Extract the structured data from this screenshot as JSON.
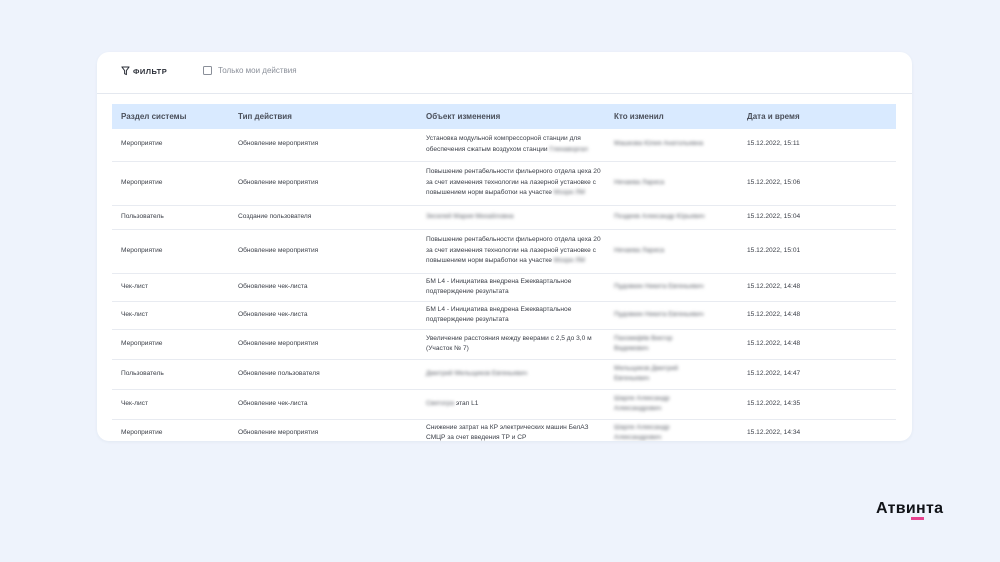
{
  "toolbar": {
    "filter_label": "ФИЛЬТР",
    "mine_only_label": "Только мои действия"
  },
  "table": {
    "columns": [
      "Раздел системы",
      "Тип действия",
      "Объект изменения",
      "Кто изменил",
      "Дата и время"
    ],
    "rows": [
      {
        "section": "Мероприятие",
        "action": "Обновление мероприятия",
        "object": "Установка модульной компрессорной станции для обеспечения сжатым воздухом станции",
        "object_blur": "Гленаворгал",
        "who": "Машкова Юлия Анатольевна",
        "who2": "",
        "date": "15.12.2022, 15:11"
      },
      {
        "section": "Мероприятие",
        "action": "Обновление мероприятия",
        "object": "Повышение рентабельности фильерного отдела цеха 20 за счет изменения технологии на лазерной установке с повышением норм выработки на участке",
        "object_blur": "Мозри ЛМ",
        "who": "Нечаева Лариса",
        "who2": "",
        "date": "15.12.2022, 15:06"
      },
      {
        "section": "Пользователь",
        "action": "Создание пользователя",
        "object": "",
        "object_blur": "Зеселей Мария Михайловна",
        "who": "Поздеев Александр Юрьевич",
        "who2": "",
        "date": "15.12.2022, 15:04"
      },
      {
        "section": "Мероприятие",
        "action": "Обновление мероприятия",
        "object": "Повышение рентабельности фильерного отдела цеха 20 за счет изменения технологии на лазерной установке с повышением норм выработки на участке",
        "object_blur": "Мозри ЛМ",
        "who": "Нечаева Лариса",
        "who2": "",
        "date": "15.12.2022, 15:01"
      },
      {
        "section": "Чек-лист",
        "action": "Обновление чек-листа",
        "object": "БМ L4 - Инициатива внедрена Ежеквартальное подтверждение результата",
        "object_blur": "",
        "who": "Пудовкин Никита Евгеньевич",
        "who2": "",
        "date": "15.12.2022, 14:48"
      },
      {
        "section": "Чек-лист",
        "action": "Обновление чек-листа",
        "object": "БМ L4 - Инициатива внедрена Ежеквартальное подтверждение результата",
        "object_blur": "",
        "who": "Пудовкин Никита Евгеньевич",
        "who2": "",
        "date": "15.12.2022, 14:48"
      },
      {
        "section": "Мероприятие",
        "action": "Обновление мероприятия",
        "object": "Увеличение расстояния между веерами с 2,5 до 3,0 м (Участок № 7)",
        "object_blur": "",
        "who": "Пахомкфёв Виктор",
        "who2": "Вадимович",
        "date": "15.12.2022, 14:48"
      },
      {
        "section": "Пользователь",
        "action": "Обновление пользователя",
        "object": "",
        "object_blur": "Дмитрий Мельщиков Евгеньевич",
        "who": "Мельщиков Дмитрий",
        "who2": "Евгеньевич",
        "date": "15.12.2022, 14:47"
      },
      {
        "section": "Чек-лист",
        "action": "Обновление чек-листа",
        "object": "этап L1",
        "object_blur": "Светогра",
        "who": "Шарле Александр",
        "who2": "Александрович",
        "date": "15.12.2022, 14:35"
      },
      {
        "section": "Мероприятие",
        "action": "Обновление мероприятия",
        "object": "Снижение затрат на КР электрических машин БелАЗ СМЦР за счет введения ТР и СР",
        "object_blur": "",
        "who": "Шарле Александр",
        "who2": "Александрович",
        "date": "15.12.2022, 14:34"
      }
    ]
  },
  "brand": {
    "logo_text": "Атвинта",
    "accent": "#e7428f"
  }
}
